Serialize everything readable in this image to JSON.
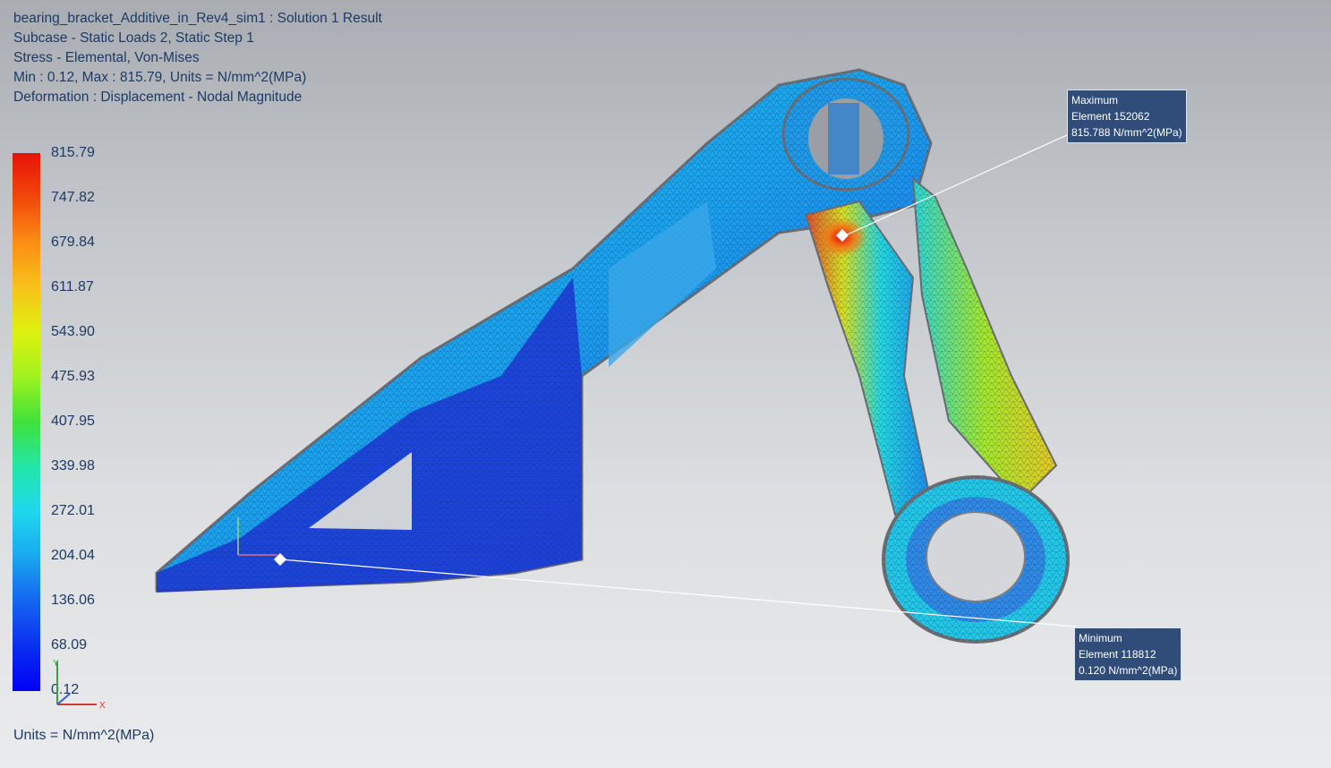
{
  "header": {
    "line1": "bearing_bracket_Additive_in_Rev4_sim1 : Solution 1 Result",
    "line2": "Subcase - Static Loads 2, Static Step 1",
    "line3": "Stress - Elemental, Von-Mises",
    "line4": "Min : 0.12, Max : 815.79, Units = N/mm^2(MPa)",
    "line5": "Deformation : Displacement - Nodal Magnitude"
  },
  "legend": {
    "ticks": [
      "815.79",
      "747.82",
      "679.84",
      "611.87",
      "543.90",
      "475.93",
      "407.95",
      "339.98",
      "272.01",
      "204.04",
      "136.06",
      "68.09",
      "0.12"
    ],
    "colors": [
      "#e8120a",
      "#f2480a",
      "#fb8e13",
      "#f7c21a",
      "#dff20f",
      "#9ff21e",
      "#3fe23a",
      "#22e6a8",
      "#1fd8ee",
      "#19a8f0",
      "#1565f0",
      "#0b2ff2",
      "#0000f5"
    ]
  },
  "units_label": "Units = N/mm^2(MPa)",
  "callouts": {
    "maximum": {
      "title": "Maximum",
      "element": "Element 152062",
      "value": "815.788 N/mm^2(MPa)"
    },
    "minimum": {
      "title": "Minimum",
      "element": "Element 118812",
      "value": "0.120 N/mm^2(MPa)"
    }
  },
  "triad": {
    "x_label": "X",
    "y_label": "Y"
  }
}
